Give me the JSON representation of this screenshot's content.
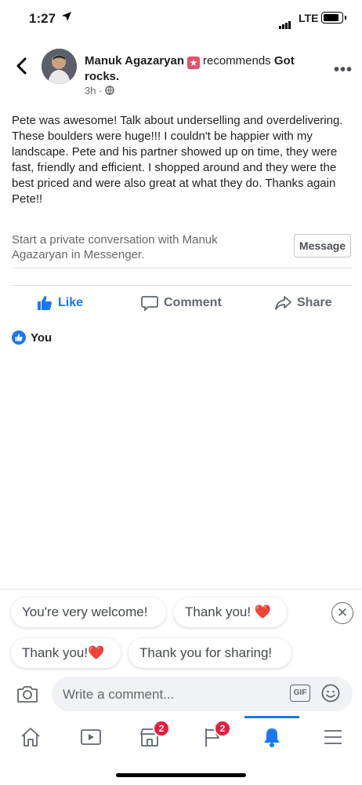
{
  "status_bar": {
    "time": "1:27",
    "network": "LTE"
  },
  "post": {
    "author": "Manuk Agazaryan",
    "action_text": "recommends",
    "page_name": "Got rocks.",
    "time_ago": "3h",
    "body": "Pete was awesome! Talk about underselling and overdelivering. These boulders were huge!!! I couldn't be happier with my landscape. Pete and his partner showed up on time, they were fast, friendly and efficient. I shopped around and they were the best priced and were also great at what they do. Thanks again Pete!!"
  },
  "messenger": {
    "prompt": "Start a private conversation with Manuk Agazaryan in Messenger.",
    "button_label": "Message"
  },
  "actions": {
    "like": "Like",
    "comment": "Comment",
    "share": "Share"
  },
  "reactions": {
    "you": "You"
  },
  "quick_replies": {
    "r1": "You're very welcome!",
    "r2": "Thank you! ❤️",
    "r3": "Thank you!❤️",
    "r4": "Thank you for sharing!"
  },
  "comment_input": {
    "placeholder": "Write a comment...",
    "gif_label": "GIF"
  },
  "tabbar": {
    "items": [
      "home-icon",
      "watch-icon",
      "marketplace-icon",
      "pages-icon",
      "notifications-icon",
      "menu-icon"
    ],
    "marketplace_badge": "2",
    "pages_badge": "2",
    "active": "notifications"
  },
  "colors": {
    "accent": "#1877f2",
    "badge": "#e41e3f",
    "recommend_badge": "#e7506b"
  }
}
